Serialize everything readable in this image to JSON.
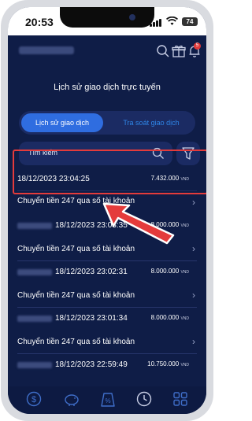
{
  "status": {
    "time": "20:53",
    "battery": "74"
  },
  "header": {
    "notification_count": "5"
  },
  "page": {
    "title": "Lịch sử giao dịch trực tuyến"
  },
  "tabs": [
    {
      "label": "Lịch sử giao dịch",
      "active": true
    },
    {
      "label": "Tra soát giao dịch",
      "active": false
    }
  ],
  "search": {
    "placeholder": "Tìm kiếm"
  },
  "transactions": [
    {
      "datetime": "18/12/2023 23:04:25",
      "amount": "7.432.000",
      "currency": "VND",
      "description": "Chuyển tiền 247 qua số tài khoản",
      "highlighted": true
    },
    {
      "datetime": "18/12/2023 23:03:35",
      "amount": "8.000.000",
      "currency": "VND",
      "description": "Chuyển tiền 247 qua số tài khoản",
      "highlighted": false
    },
    {
      "datetime": "18/12/2023 23:02:31",
      "amount": "8.000.000",
      "currency": "VND",
      "description": "Chuyển tiền 247 qua số tài khoản",
      "highlighted": false
    },
    {
      "datetime": "18/12/2023 23:01:34",
      "amount": "8.000.000",
      "currency": "VND",
      "description": "Chuyển tiền 247 qua số tài khoản",
      "highlighted": false
    },
    {
      "datetime": "18/12/2023 22:59:49",
      "amount": "10.750.000",
      "currency": "VND",
      "description": "",
      "highlighted": false
    }
  ],
  "bottom_nav": [
    {
      "icon": "dollar-icon"
    },
    {
      "icon": "piggy-bank-icon"
    },
    {
      "icon": "percent-tag-icon"
    },
    {
      "icon": "clock-icon",
      "active": true
    },
    {
      "icon": "grid-icon"
    }
  ],
  "colors": {
    "background": "#0f1d47",
    "accent": "#2f6de0",
    "highlight_border": "#e43b3b"
  }
}
